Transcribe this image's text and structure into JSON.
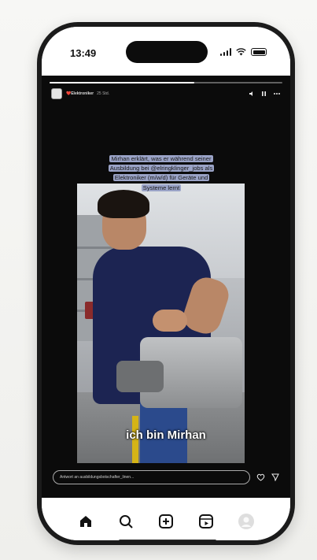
{
  "status_bar": {
    "time": "13:49"
  },
  "story": {
    "account_name": "❤️Elektroniker",
    "posted_ago": "25 Std.",
    "progress": 0.62,
    "caption": "Mirhan erklärt, was er während seiner Ausbildung bei @elringklinger_jobs als Elektroniker (m/w/d) für Geräte und Systeme lernt",
    "subtitle": "ich bin Mirhan",
    "reply_placeholder": "Antwort an ausbildungsbotschafter_linen...",
    "header_icons": [
      "mute-icon",
      "pause-icon",
      "more-icon"
    ],
    "reply_icons": [
      "heart-icon",
      "send-icon"
    ]
  },
  "bottom_nav": {
    "items": [
      "home-icon",
      "search-icon",
      "create-icon",
      "reels-icon",
      "profile-icon"
    ]
  },
  "colors": {
    "caption_bg": "#9aa3c7",
    "story_bg": "#0b0b0b"
  }
}
